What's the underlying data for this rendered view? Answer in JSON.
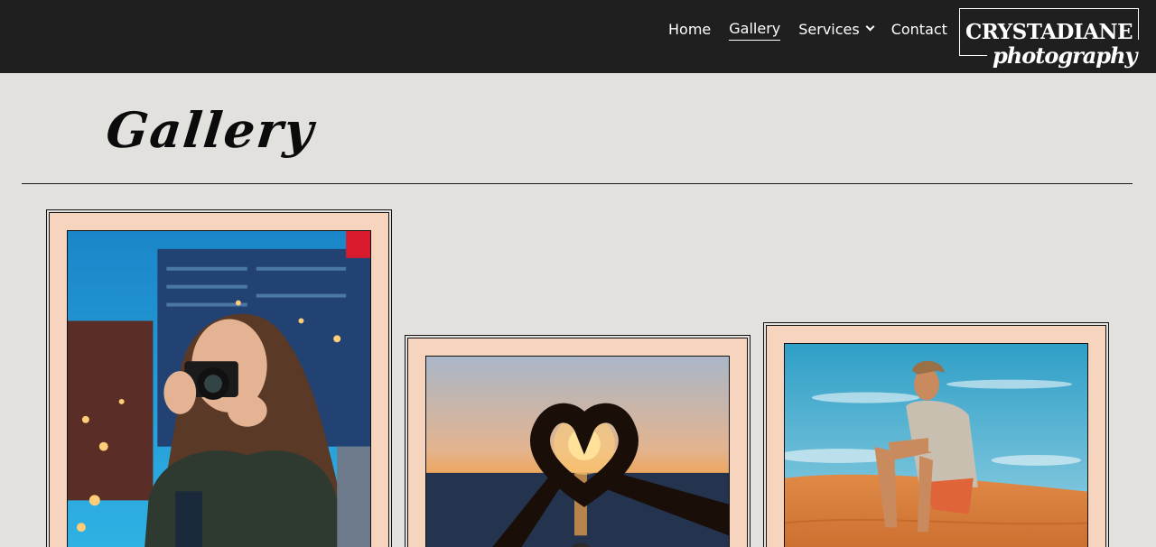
{
  "nav": {
    "home": "Home",
    "gallery": "Gallery",
    "services": "Services",
    "contact": "Contact"
  },
  "logo": {
    "top": "CRYSTADIANE",
    "script": "photography"
  },
  "page": {
    "title": "Gallery"
  },
  "gallery": {
    "items": [
      {
        "icon": "woman-with-camera-photo"
      },
      {
        "icon": "heart-hands-sunset-photo"
      },
      {
        "icon": "man-sitting-desert-photo"
      }
    ]
  },
  "colors": {
    "header_bg": "#1f1f1f",
    "page_bg": "#e2e1dd",
    "frame_mat": "#f6d4bd"
  }
}
